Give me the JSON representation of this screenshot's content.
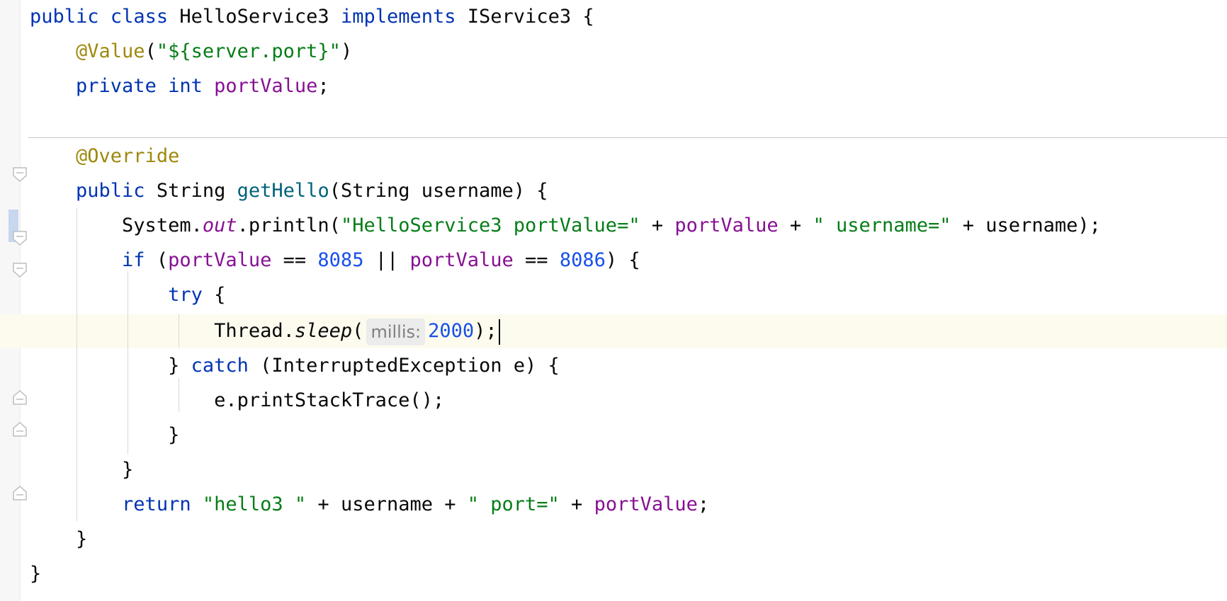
{
  "code": {
    "l1": {
      "public": "public",
      "class": "class",
      "name": "HelloService3",
      "implements": "implements",
      "iface": "IService3",
      "brace": "{"
    },
    "l2": {
      "annotation": "@Value",
      "open": "(",
      "str": "\"${server.port}\"",
      "close": ")"
    },
    "l3": {
      "private": "private",
      "int": "int",
      "field": "portValue",
      "semi": ";"
    },
    "l5": {
      "annotation": "@Override"
    },
    "l6": {
      "public": "public",
      "type": "String",
      "method": "getHello",
      "params": "(String username) {"
    },
    "l7": {
      "pre": "System.",
      "out": "out",
      "mid": ".println(",
      "str1": "\"HelloService3 portValue=\"",
      "plus1": " + ",
      "field": "portValue",
      "plus2": " + ",
      "str2": "\" username=\"",
      "end": " + username);"
    },
    "l8": {
      "if": "if",
      "open": " (",
      "f1": "portValue",
      "eq1": " == ",
      "n1": "8085",
      "or": " || ",
      "f2": "portValue",
      "eq2": " == ",
      "n2": "8086",
      "close": ") {"
    },
    "l9": {
      "try": "try",
      "brace": " {"
    },
    "l10": {
      "pre": "Thread.",
      "sleep": "sleep",
      "open": "(",
      "hint": "millis:",
      "num": "2000",
      "end": ");"
    },
    "l11": {
      "pre": "} ",
      "catch": "catch",
      "rest": " (InterruptedException e) {"
    },
    "l12": {
      "text": "e.printStackTrace();"
    },
    "l13": {
      "text": "}"
    },
    "l14": {
      "text": "}"
    },
    "l15": {
      "return": "return",
      "s1": "\"hello3 \"",
      "mid": " + username + ",
      "s2": "\" port=\"",
      "plus": " + ",
      "field": "portValue",
      "semi": ";"
    },
    "l16": {
      "text": "}"
    },
    "l17": {
      "text": "}"
    }
  },
  "colors": {
    "keyword": "#0033b3",
    "annotation": "#9e880d",
    "string": "#067d17",
    "field": "#871094",
    "number": "#1750eb",
    "method": "#00627a",
    "caret_row": "#fdfbee"
  }
}
